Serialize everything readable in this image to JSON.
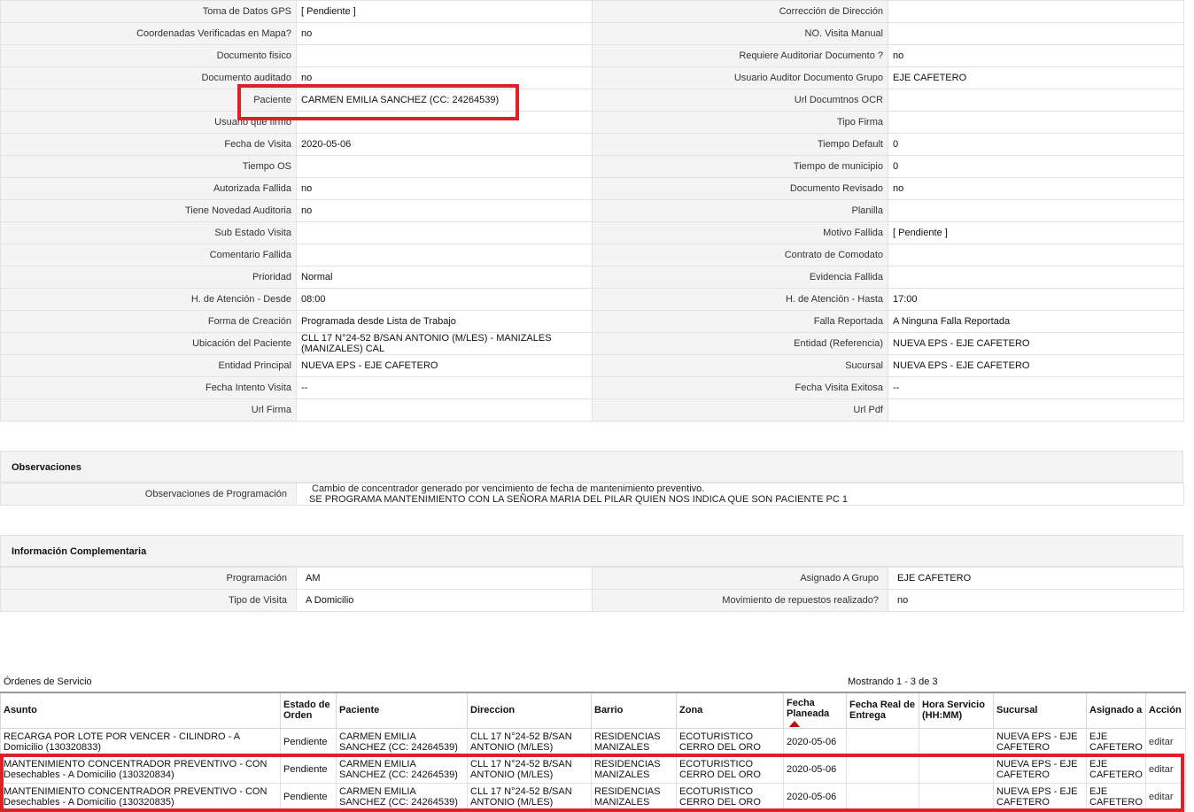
{
  "details": [
    [
      "Toma de Datos GPS",
      "[ Pendiente ]",
      "Corrección de Dirección",
      ""
    ],
    [
      "Coordenadas Verificadas en Mapa?",
      "no",
      "NO. Visita Manual",
      ""
    ],
    [
      "Documento fisico",
      "",
      "Requiere Auditoriar Documento ?",
      "no"
    ],
    [
      "Documento auditado",
      "no",
      "Usuario Auditor Documento Grupo",
      "EJE CAFETERO"
    ],
    [
      "Paciente",
      "CARMEN EMILIA SANCHEZ (CC: 24264539)",
      "Url Documtnos OCR",
      ""
    ],
    [
      "Usuario que firmo",
      "",
      "Tipo Firma",
      ""
    ],
    [
      "Fecha de Visita",
      "2020-05-06",
      "Tiempo Default",
      "0"
    ],
    [
      "Tiempo OS",
      "",
      "Tiempo de municipio",
      "0"
    ],
    [
      "Autorizada Fallida",
      "no",
      "Documento Revisado",
      "no"
    ],
    [
      "Tiene Novedad Auditoria",
      "no",
      "Planilla",
      ""
    ],
    [
      "Sub Estado Visita",
      "",
      "Motivo Fallida",
      "[ Pendiente ]"
    ],
    [
      "Comentario Fallida",
      "",
      "Contrato de Comodato",
      ""
    ],
    [
      "Prioridad",
      "Normal",
      "Evidencia Fallida",
      ""
    ],
    [
      "H. de Atención - Desde",
      "08:00",
      "H. de Atención - Hasta",
      "17:00"
    ],
    [
      "Forma de Creación",
      "Programada desde Lista de Trabajo",
      "Falla Reportada",
      "A Ninguna Falla Reportada"
    ],
    [
      "Ubicación del Paciente",
      "CLL 17 N°24-52 B/SAN ANTONIO (M/LES) - MANIZALES (MANIZALES) CAL",
      "Entidad (Referencia)",
      "NUEVA EPS - EJE CAFETERO"
    ],
    [
      "Entidad Principal",
      "NUEVA EPS - EJE CAFETERO",
      "Sucursal",
      "NUEVA EPS - EJE CAFETERO"
    ],
    [
      "Fecha Intento Visita",
      "--",
      "Fecha Visita Exitosa",
      "--"
    ],
    [
      "Url Firma",
      "",
      "Url Pdf",
      ""
    ]
  ],
  "observaciones": {
    "title": "Observaciones",
    "label": "Observaciones de Programación",
    "line1": "Cambio de concentrador generado por vencimiento de fecha de mantenimiento preventivo.",
    "line2": "SE PROGRAMA MANTENIMIENTO CON LA SEÑORA MARIA DEL PILAR QUIEN NOS INDICA QUE SON PACIENTE PC 1"
  },
  "complementaria": {
    "title": "Información Complementaria",
    "rows": [
      [
        "Programación",
        "AM",
        "Asignado A Grupo",
        "EJE CAFETERO"
      ],
      [
        "Tipo de Visita",
        "A Domicilio",
        "Movimiento de repuestos realizado?",
        "no"
      ]
    ]
  },
  "orders": {
    "title": "Órdenes de Servicio",
    "showing": "Mostrando 1 - 3 de 3",
    "columns": [
      "Asunto",
      "Estado de Orden",
      "Paciente",
      "Direccion",
      "Barrio",
      "Zona",
      "Fecha Planeada",
      "Fecha Real de Entrega",
      "Hora Servicio (HH:MM)",
      "Sucursal",
      "Asignado a",
      "Acción"
    ],
    "rows": [
      [
        "RECARGA POR LOTE POR VENCER - CILINDRO - A Domicilio (130320833)",
        "Pendiente",
        "CARMEN EMILIA SANCHEZ (CC: 24264539)",
        "CLL 17 N°24-52 B/SAN ANTONIO (M/LES)",
        "RESIDENCIAS MANIZALES",
        "ECOTURISTICO CERRO DEL ORO",
        "2020-05-06",
        "",
        "",
        "NUEVA EPS - EJE CAFETERO",
        "EJE CAFETERO",
        "editar"
      ],
      [
        "MANTENIMIENTO CONCENTRADOR PREVENTIVO - CON Desechables - A Domicilio (130320834)",
        "Pendiente",
        "CARMEN EMILIA SANCHEZ (CC: 24264539)",
        "CLL 17 N°24-52 B/SAN ANTONIO (M/LES)",
        "RESIDENCIAS MANIZALES",
        "ECOTURISTICO CERRO DEL ORO",
        "2020-05-06",
        "",
        "",
        "NUEVA EPS - EJE CAFETERO",
        "EJE CAFETERO",
        "editar"
      ],
      [
        "MANTENIMIENTO CONCENTRADOR PREVENTIVO - CON Desechables - A Domicilio (130320835)",
        "Pendiente",
        "CARMEN EMILIA SANCHEZ (CC: 24264539)",
        "CLL 17 N°24-52 B/SAN ANTONIO (M/LES)",
        "RESIDENCIAS MANIZALES",
        "ECOTURISTICO CERRO DEL ORO",
        "2020-05-06",
        "",
        "",
        "NUEVA EPS - EJE CAFETERO",
        "EJE CAFETERO",
        "editar"
      ]
    ]
  },
  "colors": {
    "highlight": "#e01f2a",
    "label_bg": "#f4f4f4",
    "border": "#e2e2e2"
  }
}
